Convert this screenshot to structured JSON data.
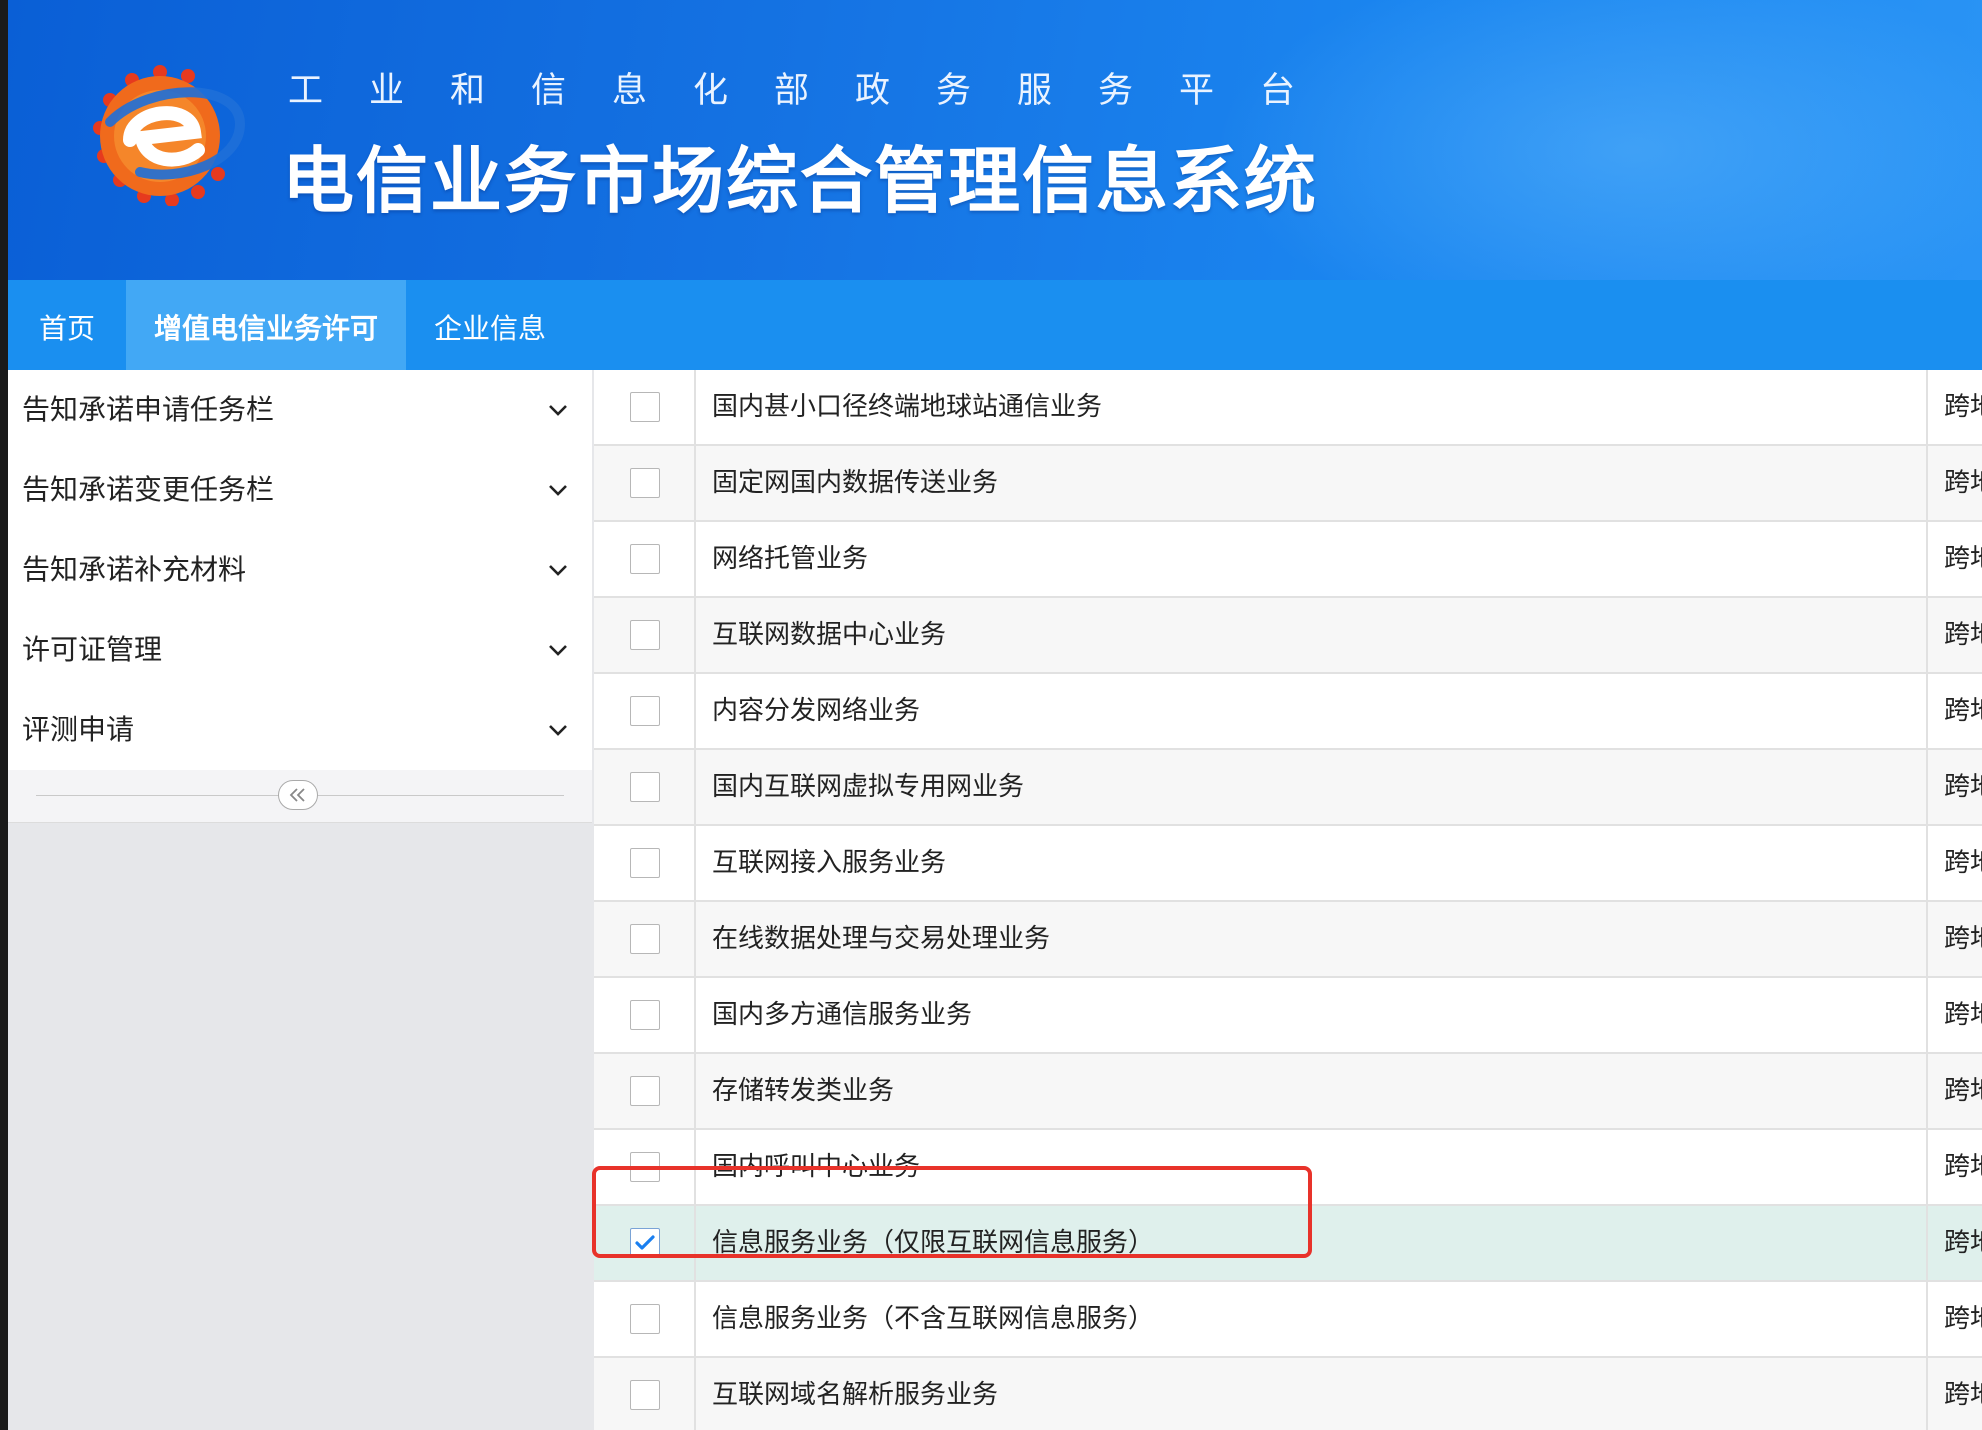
{
  "header": {
    "subtitle": "工业和信息化部政务服务平台",
    "title": "电信业务市场综合管理信息系统"
  },
  "nav": {
    "tabs": [
      {
        "label": "首页"
      },
      {
        "label": "增值电信业务许可",
        "active": true
      },
      {
        "label": "企业信息"
      }
    ]
  },
  "sidebar": {
    "items": [
      {
        "label": "告知承诺申请任务栏"
      },
      {
        "label": "告知承诺变更任务栏"
      },
      {
        "label": "告知承诺补充材料"
      },
      {
        "label": "许可证管理"
      },
      {
        "label": "评测申请"
      }
    ]
  },
  "table": {
    "rows": [
      {
        "name": "国内甚小口径终端地球站通信业务",
        "scope": "跨地",
        "checked": false
      },
      {
        "name": "固定网国内数据传送业务",
        "scope": "跨地",
        "checked": false
      },
      {
        "name": "网络托管业务",
        "scope": "跨地",
        "checked": false
      },
      {
        "name": "互联网数据中心业务",
        "scope": "跨地",
        "checked": false
      },
      {
        "name": "内容分发网络业务",
        "scope": "跨地",
        "checked": false
      },
      {
        "name": "国内互联网虚拟专用网业务",
        "scope": "跨地",
        "checked": false
      },
      {
        "name": "互联网接入服务业务",
        "scope": "跨地",
        "checked": false
      },
      {
        "name": "在线数据处理与交易处理业务",
        "scope": "跨地",
        "checked": false
      },
      {
        "name": "国内多方通信服务业务",
        "scope": "跨地",
        "checked": false
      },
      {
        "name": "存储转发类业务",
        "scope": "跨地",
        "checked": false
      },
      {
        "name": "国内呼叫中心业务",
        "scope": "跨地",
        "checked": false
      },
      {
        "name": "信息服务业务（仅限互联网信息服务）",
        "scope": "跨地",
        "checked": true
      },
      {
        "name": "信息服务业务（不含互联网信息服务）",
        "scope": "跨地",
        "checked": false
      },
      {
        "name": "互联网域名解析服务业务",
        "scope": "跨地",
        "checked": false
      }
    ]
  },
  "colors": {
    "banner": "#1573e3",
    "nav": "#1a8ff0",
    "nav_active": "#42a8f5",
    "selected_row": "#dff0ec",
    "highlight_border": "#e8322a",
    "checkbox_check": "#1a7ff0"
  },
  "icons": {
    "logo": "orange-gear-e-logo-icon",
    "chevron": "chevron-down-icon",
    "collapse": "double-chevron-left-icon",
    "check": "checkmark-icon"
  }
}
